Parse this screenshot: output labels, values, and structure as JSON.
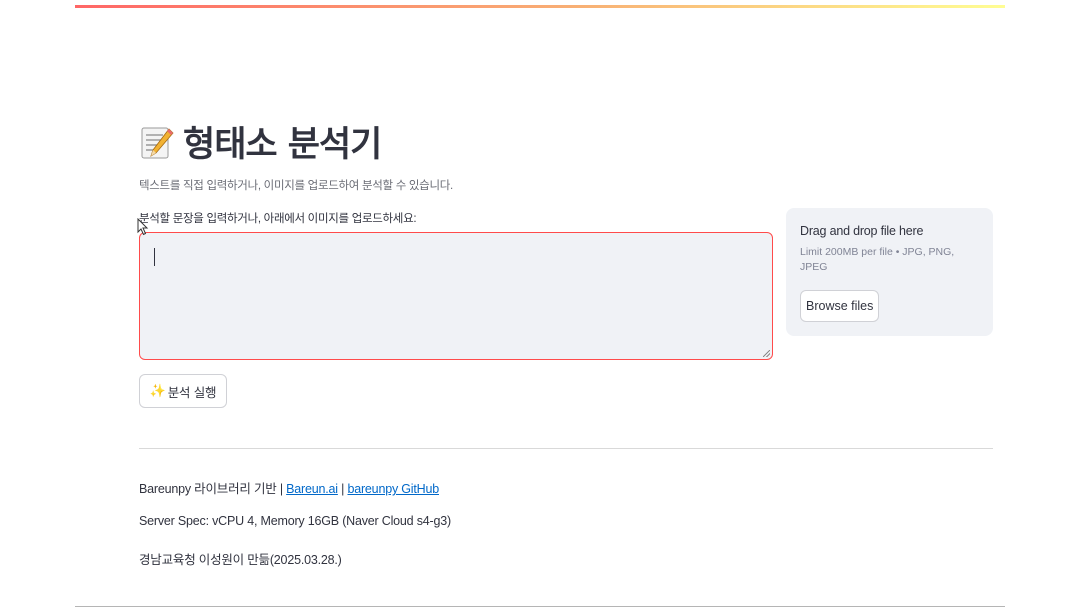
{
  "header": {
    "title": "형태소 분석기",
    "title_icon": "memo-icon",
    "caption": "텍스트를 직접 입력하거나, 이미지를 업로드하여 분석할 수 있습니다."
  },
  "input": {
    "label": "분석할 문장을 입력하거나, 아래에서 이미지를 업로드하세요:",
    "value": ""
  },
  "uploader": {
    "drag_text": "Drag and drop file here",
    "limit_text": "Limit 200MB per file • JPG, PNG, JPEG",
    "browse_label": "Browse files"
  },
  "run_button": {
    "icon": "sparkles-icon",
    "label": "분석 실행"
  },
  "footer": {
    "lib_prefix": "Bareunpy 라이브러리 기반 | ",
    "link_bareun": "Bareun.ai",
    "separator": " | ",
    "link_github": "bareunpy GitHub",
    "server_spec": "Server Spec: vCPU 4, Memory 16GB (Naver Cloud s4-g3)",
    "author": "경남교육청 이성원이 만듦(2025.03.28.)"
  },
  "colors": {
    "accent": "#ff4b4b",
    "link": "#0068c9",
    "panel_bg": "#f0f2f6",
    "text": "#31333f"
  }
}
